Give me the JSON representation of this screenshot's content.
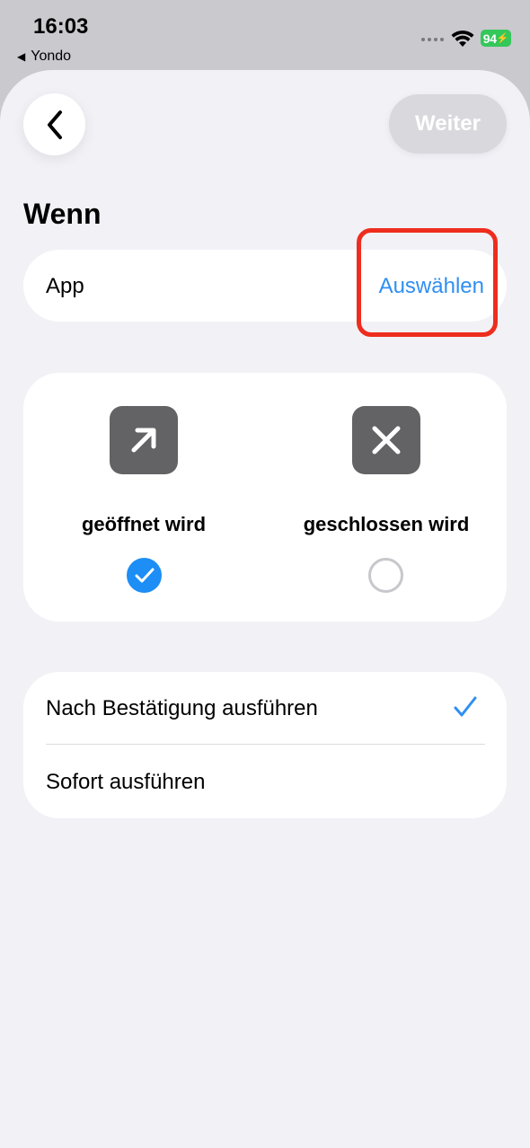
{
  "status": {
    "time": "16:03",
    "back_app": "Yondo",
    "battery": "94"
  },
  "header": {
    "next_label": "Weiter"
  },
  "section": {
    "title": "Wenn"
  },
  "app_row": {
    "label": "App",
    "action": "Auswählen"
  },
  "triggers": [
    {
      "label": "geöffnet wird",
      "icon": "arrow-up-right-icon",
      "selected": true
    },
    {
      "label": "geschlossen wird",
      "icon": "close-x-icon",
      "selected": false
    }
  ],
  "modes": [
    {
      "label": "Nach Bestätigung ausführen",
      "checked": true
    },
    {
      "label": "Sofort ausführen",
      "checked": false
    }
  ],
  "colors": {
    "accent": "#2f8ff3",
    "highlight": "#ee2d1e",
    "battery": "#34c759"
  }
}
